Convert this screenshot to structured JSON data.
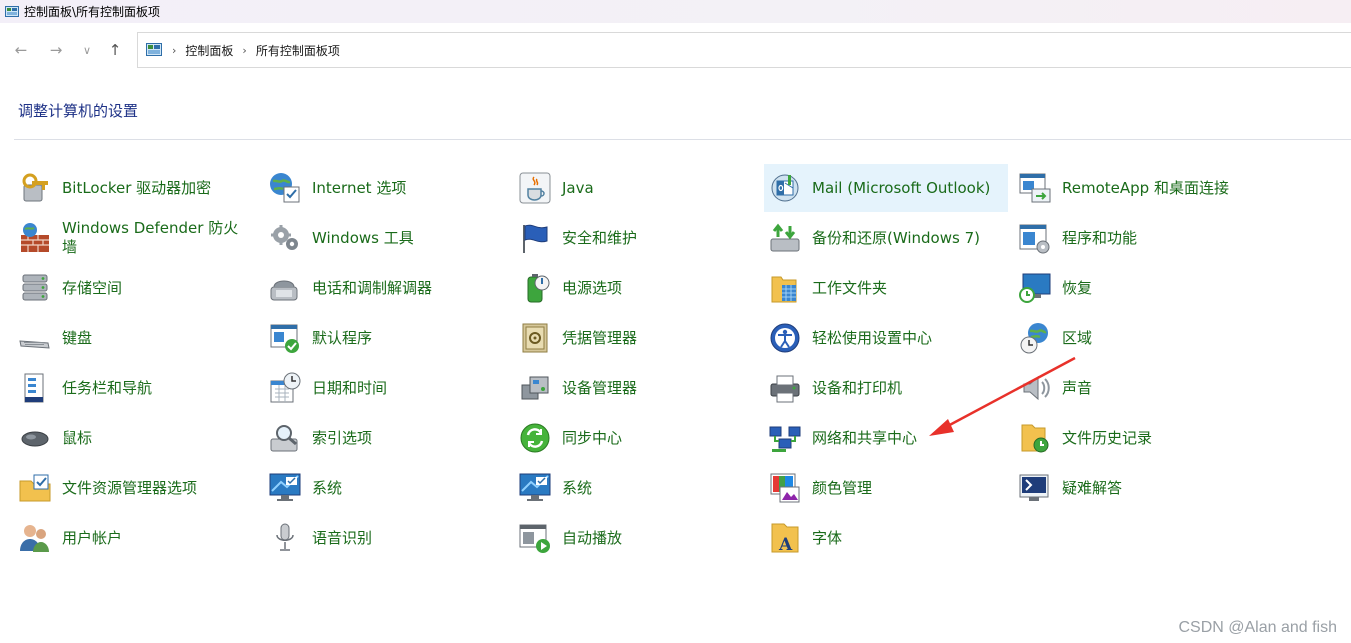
{
  "window": {
    "title": "控制面板\\所有控制面板项"
  },
  "nav": {
    "back_icon": "arrow-left-icon",
    "forward_icon": "arrow-right-icon",
    "recent_icon": "chevron-down-icon",
    "up_icon": "arrow-up-icon"
  },
  "breadcrumb": {
    "root": "控制面板",
    "current": "所有控制面板项"
  },
  "page": {
    "heading": "调整计算机的设置"
  },
  "items": [
    {
      "label": "BitLocker 驱动器加密",
      "icon": "bitlocker-key-icon"
    },
    {
      "label": "Windows Defender 防火墙",
      "icon": "firewall-icon"
    },
    {
      "label": "存储空间",
      "icon": "storage-drives-icon"
    },
    {
      "label": "键盘",
      "icon": "keyboard-icon"
    },
    {
      "label": "任务栏和导航",
      "icon": "taskbar-icon"
    },
    {
      "label": "鼠标",
      "icon": "mouse-icon"
    },
    {
      "label": "文件资源管理器选项",
      "icon": "folder-options-icon"
    },
    {
      "label": "用户帐户",
      "icon": "user-accounts-icon"
    },
    {
      "label": "Internet 选项",
      "icon": "internet-globe-icon"
    },
    {
      "label": "Windows 工具",
      "icon": "gears-icon"
    },
    {
      "label": "电话和调制解调器",
      "icon": "phone-modem-icon"
    },
    {
      "label": "默认程序",
      "icon": "default-programs-icon"
    },
    {
      "label": "日期和时间",
      "icon": "calendar-clock-icon"
    },
    {
      "label": "索引选项",
      "icon": "indexing-magnifier-icon"
    },
    {
      "label": "系统",
      "icon": "system-monitor-icon"
    },
    {
      "label": "语音识别",
      "icon": "microphone-icon"
    },
    {
      "label": "Java",
      "icon": "java-cup-icon"
    },
    {
      "label": "安全和维护",
      "icon": "security-flag-icon"
    },
    {
      "label": "电源选项",
      "icon": "power-battery-icon"
    },
    {
      "label": "凭据管理器",
      "icon": "credential-vault-icon"
    },
    {
      "label": "设备管理器",
      "icon": "device-manager-icon"
    },
    {
      "label": "同步中心",
      "icon": "sync-center-icon"
    },
    {
      "label": "系统",
      "icon": "system-monitor-icon"
    },
    {
      "label": "自动播放",
      "icon": "autoplay-icon"
    },
    {
      "label": "Mail (Microsoft Outlook)",
      "icon": "mail-outlook-icon",
      "selected": true
    },
    {
      "label": "备份和还原(Windows 7)",
      "icon": "backup-restore-icon"
    },
    {
      "label": "工作文件夹",
      "icon": "work-folders-icon"
    },
    {
      "label": "轻松使用设置中心",
      "icon": "ease-of-access-icon"
    },
    {
      "label": "设备和打印机",
      "icon": "printer-icon"
    },
    {
      "label": "网络和共享中心",
      "icon": "network-sharing-icon"
    },
    {
      "label": "颜色管理",
      "icon": "color-management-icon"
    },
    {
      "label": "字体",
      "icon": "fonts-icon"
    },
    {
      "label": "RemoteApp 和桌面连接",
      "icon": "remote-desktop-icon"
    },
    {
      "label": "程序和功能",
      "icon": "programs-features-icon"
    },
    {
      "label": "恢复",
      "icon": "recovery-icon"
    },
    {
      "label": "区域",
      "icon": "region-globe-clock-icon"
    },
    {
      "label": "声音",
      "icon": "speaker-icon"
    },
    {
      "label": "文件历史记录",
      "icon": "file-history-icon"
    },
    {
      "label": "疑难解答",
      "icon": "troubleshooting-icon"
    }
  ],
  "annotation": {
    "arrow_color": "#e8312a",
    "points_to": "网络和共享中心"
  },
  "watermark": "CSDN @Alan and fish"
}
